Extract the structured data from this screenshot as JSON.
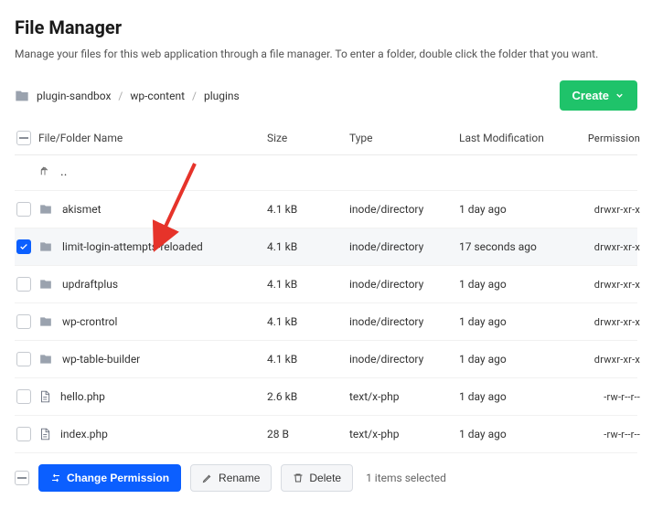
{
  "header": {
    "title": "File Manager",
    "subtitle": "Manage your files for this web application through a file manager. To enter a folder, double click the folder that you want."
  },
  "breadcrumbs": [
    "plugin-sandbox",
    "wp-content",
    "plugins"
  ],
  "create_label": "Create",
  "columns": {
    "name": "File/Folder Name",
    "size": "Size",
    "type": "Type",
    "mod": "Last Modification",
    "perm": "Permission"
  },
  "parent_label": "..",
  "rows": [
    {
      "name": "akismet",
      "kind": "folder",
      "size": "4.1 kB",
      "type": "inode/directory",
      "mod": "1 day ago",
      "perm": "drwxr-xr-x",
      "checked": false
    },
    {
      "name": "limit-login-attempts-reloaded",
      "kind": "folder",
      "size": "4.1 kB",
      "type": "inode/directory",
      "mod": "17 seconds ago",
      "perm": "drwxr-xr-x",
      "checked": true
    },
    {
      "name": "updraftplus",
      "kind": "folder",
      "size": "4.1 kB",
      "type": "inode/directory",
      "mod": "1 day ago",
      "perm": "drwxr-xr-x",
      "checked": false
    },
    {
      "name": "wp-crontrol",
      "kind": "folder",
      "size": "4.1 kB",
      "type": "inode/directory",
      "mod": "1 day ago",
      "perm": "drwxr-xr-x",
      "checked": false
    },
    {
      "name": "wp-table-builder",
      "kind": "folder",
      "size": "4.1 kB",
      "type": "inode/directory",
      "mod": "1 day ago",
      "perm": "drwxr-xr-x",
      "checked": false
    },
    {
      "name": "hello.php",
      "kind": "file",
      "size": "2.6 kB",
      "type": "text/x-php",
      "mod": "1 day ago",
      "perm": "-rw-r--r--",
      "checked": false
    },
    {
      "name": "index.php",
      "kind": "file",
      "size": "28 B",
      "type": "text/x-php",
      "mod": "1 day ago",
      "perm": "-rw-r--r--",
      "checked": false
    }
  ],
  "actions": {
    "change_permission": "Change Permission",
    "rename": "Rename",
    "delete": "Delete"
  },
  "selection_text": "1 items selected"
}
